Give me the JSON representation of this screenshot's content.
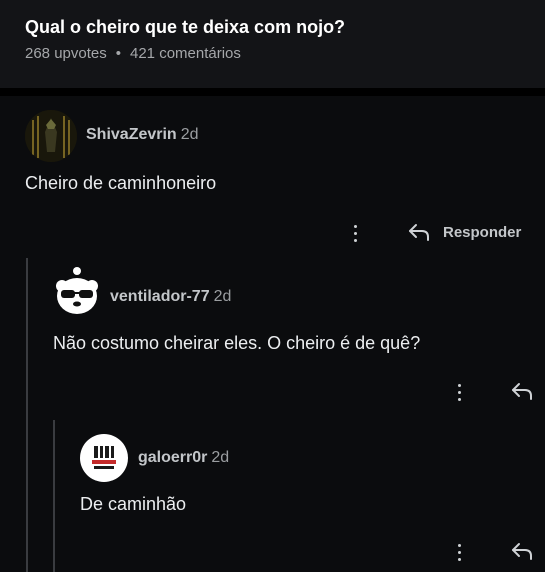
{
  "post": {
    "title": "Qual o cheiro que te deixa com nojo?",
    "upvotes": "268 upvotes",
    "separator": "•",
    "comments": "421 comentários"
  },
  "comments": [
    {
      "username": "ShivaZevrin",
      "time": "2d",
      "text": "Cheiro de caminhoneiro",
      "reply_label": "Responder"
    },
    {
      "username": "ventilador-77",
      "time": "2d",
      "text": "Não costumo cheirar eles. O cheiro é de quê?"
    },
    {
      "username": "galoerr0r",
      "time": "2d",
      "text": "De caminhão"
    }
  ],
  "icons": {
    "more": "more-vertical-icon",
    "reply": "reply-arrow-icon"
  },
  "colors": {
    "background": "#0b0c0e",
    "header": "#131417",
    "text": "#eceef0",
    "muted": "#a5a7aa",
    "thread_line": "#3a3c40"
  }
}
